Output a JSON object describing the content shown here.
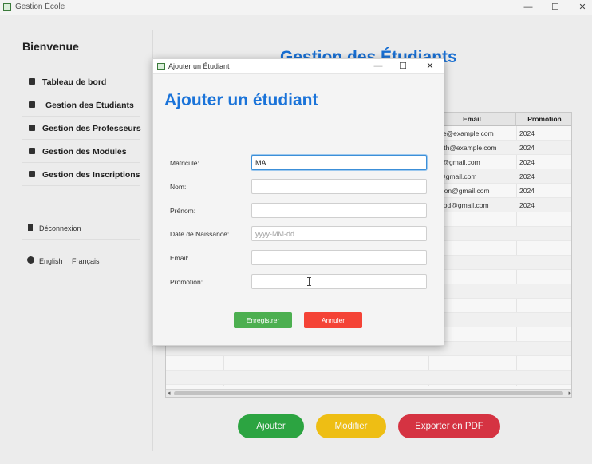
{
  "window": {
    "title": "Gestion École",
    "minimize_glyph": "—",
    "maximize_glyph": "☐",
    "close_glyph": "✕"
  },
  "sidebar": {
    "welcome": "Bienvenue",
    "items": [
      {
        "label": "Tableau de bord",
        "icon": "home-icon"
      },
      {
        "label": "Gestion des Étudiants",
        "icon": "student-icon"
      },
      {
        "label": "Gestion des Professeurs",
        "icon": "teacher-icon"
      },
      {
        "label": "Gestion des Modules",
        "icon": "book-icon"
      },
      {
        "label": "Gestion des Inscriptions",
        "icon": "enrollment-icon"
      }
    ],
    "logout": "Déconnexion",
    "lang_english": "English",
    "lang_french": "Français"
  },
  "main": {
    "title": "Gestion des Étudiants",
    "table": {
      "columns": [
        "Email",
        "Promotion"
      ],
      "rows": [
        {
          "email": ".doe@example.com",
          "promotion": "2024"
        },
        {
          "email": "smith@example.com",
          "promotion": "2024"
        },
        {
          "email": "nia@gmail.com",
          "promotion": "2024"
        },
        {
          "email": "m@gmail.com",
          "promotion": "2024"
        },
        {
          "email": "ington@gmail.com",
          "promotion": "2024"
        },
        {
          "email": "lwood@gmail.com",
          "promotion": "2024"
        }
      ]
    },
    "buttons": {
      "add": "Ajouter",
      "edit": "Modifier",
      "export": "Exporter en PDF"
    }
  },
  "dialog": {
    "window_title": "Ajouter un Étudiant",
    "heading": "Ajouter un étudiant",
    "fields": {
      "matricule": {
        "label": "Matricule:",
        "value": "MA",
        "placeholder": ""
      },
      "nom": {
        "label": "Nom:",
        "value": "",
        "placeholder": ""
      },
      "prenom": {
        "label": "Prénom:",
        "value": "",
        "placeholder": ""
      },
      "date_naissance": {
        "label": "Date de Naissance:",
        "value": "",
        "placeholder": "yyyy-MM-dd"
      },
      "email": {
        "label": "Email:",
        "value": "",
        "placeholder": ""
      },
      "promotion": {
        "label": "Promotion:",
        "value": "",
        "placeholder": ""
      }
    },
    "save_label": "Enregistrer",
    "cancel_label": "Annuler"
  },
  "colors": {
    "accent_blue": "#1a73d9",
    "add_green": "#2eaa44",
    "edit_yellow": "#f6c515",
    "export_red": "#dc3545",
    "save_green": "#4caf50",
    "cancel_red": "#f44336"
  }
}
